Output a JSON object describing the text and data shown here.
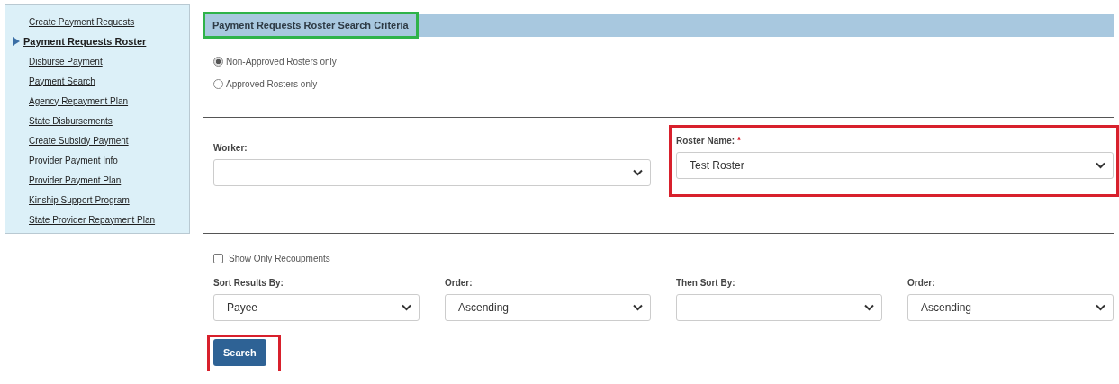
{
  "sidebar": {
    "items": [
      {
        "label": "Create Payment Requests",
        "selected": false
      },
      {
        "label": "Payment Requests Roster",
        "selected": true
      },
      {
        "label": "Disburse Payment",
        "selected": false
      },
      {
        "label": "Payment Search",
        "selected": false
      },
      {
        "label": "Agency Repayment Plan",
        "selected": false
      },
      {
        "label": "State Disbursements",
        "selected": false
      },
      {
        "label": "Create Subsidy Payment",
        "selected": false
      },
      {
        "label": "Provider Payment Info",
        "selected": false
      },
      {
        "label": "Provider Payment Plan",
        "selected": false
      },
      {
        "label": "Kinship Support Program",
        "selected": false
      },
      {
        "label": "State Provider Repayment Plan",
        "selected": false
      }
    ]
  },
  "section": {
    "title": "Payment Requests Roster Search Criteria",
    "highlighted": true
  },
  "radios": [
    {
      "label": "Non-Approved Rosters only",
      "selected": true
    },
    {
      "label": "Approved Rosters only",
      "selected": false
    }
  ],
  "worker": {
    "label": "Worker:"
  },
  "roster_name": {
    "label": "Roster Name:",
    "required": "*",
    "value": "Test Roster",
    "highlighted": true
  },
  "show_only_recoupments": {
    "label": "Show Only Recoupments",
    "checked": false
  },
  "sort_fields": [
    {
      "label": "Sort Results By:",
      "value": "Payee"
    },
    {
      "label": "Order:",
      "value": "Ascending"
    },
    {
      "label": "Then Sort By:"
    },
    {
      "label": "Order:",
      "value": "Ascending"
    }
  ],
  "search_button": {
    "label": "Search",
    "highlighted": true
  }
}
